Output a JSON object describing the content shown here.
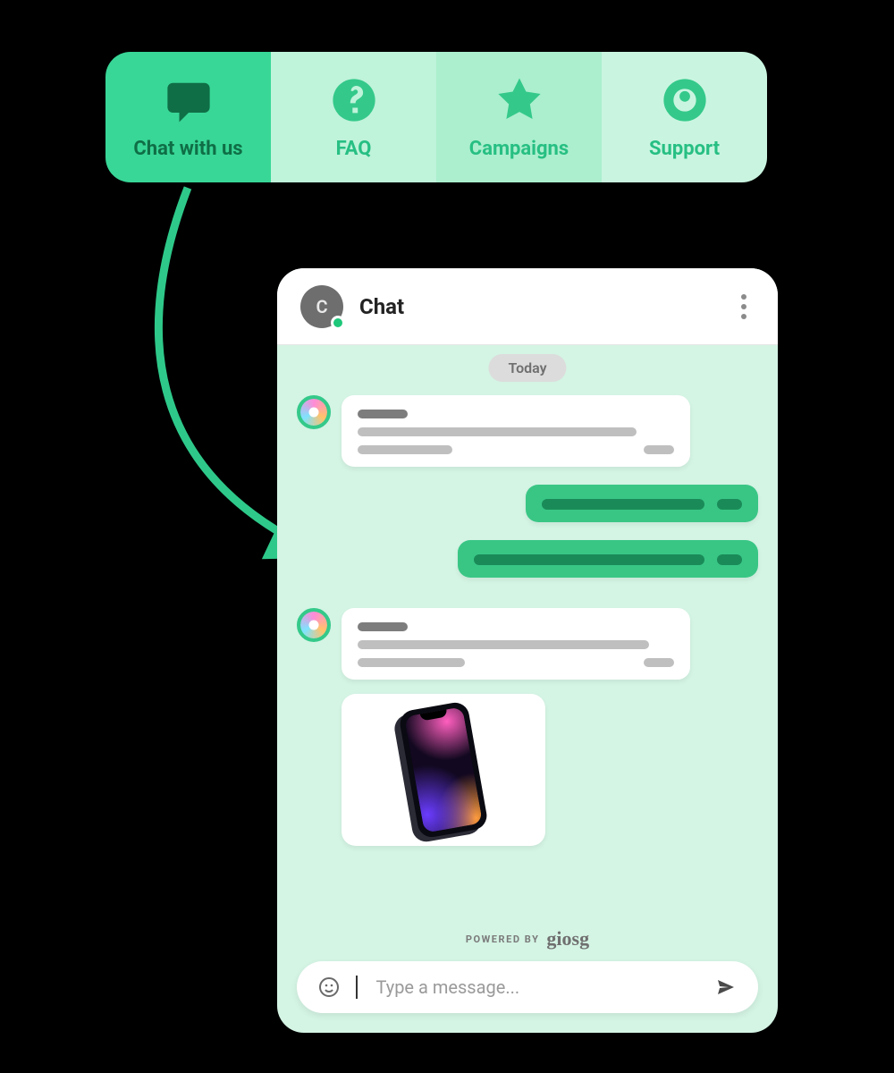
{
  "tabs": {
    "items": [
      {
        "label": "Chat with us",
        "icon": "chat-bubble-icon",
        "active": true
      },
      {
        "label": "FAQ",
        "icon": "question-circle-icon",
        "active": false
      },
      {
        "label": "Campaigns",
        "icon": "star-icon",
        "active": false
      },
      {
        "label": "Support",
        "icon": "target-circle-icon",
        "active": false
      }
    ]
  },
  "chat": {
    "avatar_letter": "C",
    "title": "Chat",
    "date_label": "Today",
    "powered_by_label": "POWERED BY",
    "powered_by_brand": "giosg",
    "composer_placeholder": "Type a message..."
  }
}
